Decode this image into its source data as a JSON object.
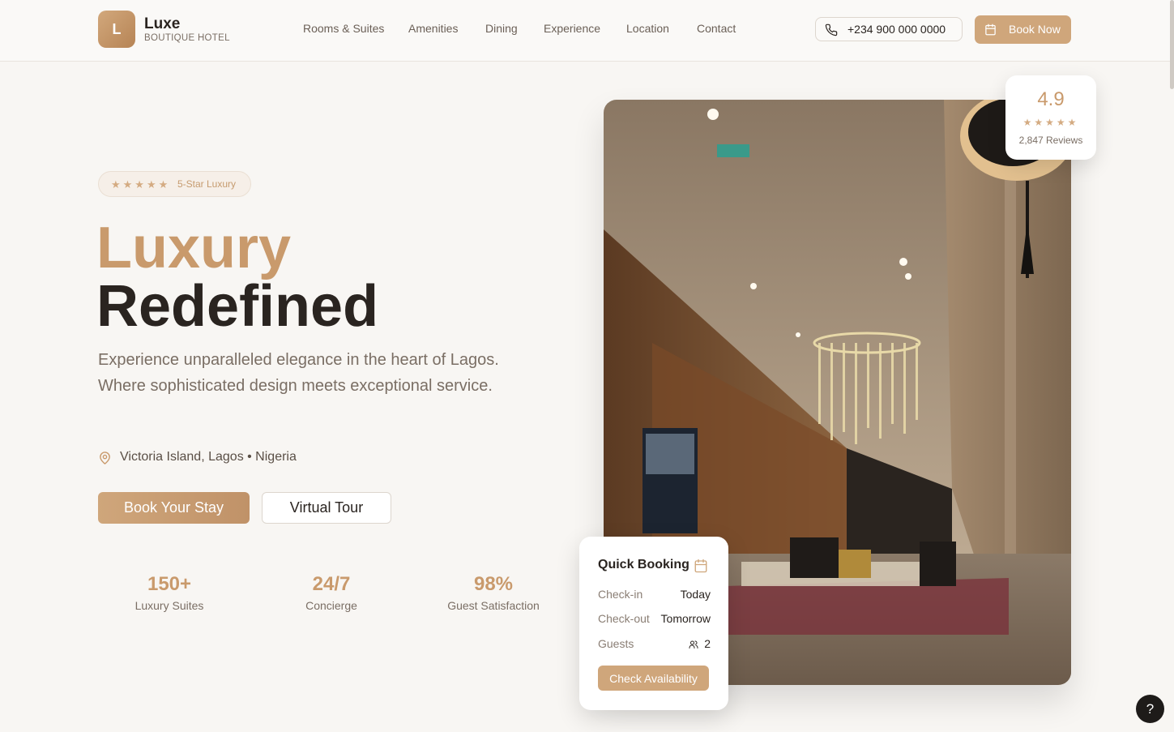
{
  "brand": {
    "initial": "L",
    "name": "Luxe",
    "tagline": "BOUTIQUE HOTEL"
  },
  "nav": {
    "items": [
      {
        "label": "Rooms & Suites"
      },
      {
        "label": "Amenities"
      },
      {
        "label": "Dining"
      },
      {
        "label": "Experience"
      },
      {
        "label": "Location"
      },
      {
        "label": "Contact"
      }
    ]
  },
  "header": {
    "phone": "+234 900 000 0000",
    "book_label": "Book Now"
  },
  "hero": {
    "badge_stars": "★★★★★",
    "badge_label": "5-Star Luxury",
    "title_line1": "Luxury",
    "title_line2": "Redefined",
    "subtitle": "Experience unparalleled elegance in the heart of Lagos. Where sophisticated design meets exceptional service.",
    "location": "Victoria Island, Lagos • Nigeria",
    "primary_cta": "Book Your Stay",
    "secondary_cta": "Virtual Tour"
  },
  "stats": [
    {
      "value": "150+",
      "label": "Luxury Suites"
    },
    {
      "value": "24/7",
      "label": "Concierge"
    },
    {
      "value": "98%",
      "label": "Guest Satisfaction"
    }
  ],
  "rating": {
    "score": "4.9",
    "stars": "★★★★★",
    "reviews": "2,847 Reviews"
  },
  "quick_booking": {
    "title": "Quick Booking",
    "checkin_label": "Check-in",
    "checkin_value": "Today",
    "checkout_label": "Check-out",
    "checkout_value": "Tomorrow",
    "guests_label": "Guests",
    "guests_value": "2",
    "cta": "Check Availability"
  },
  "help_label": "?",
  "colors": {
    "accent": "#cfa67b",
    "accent_text": "#c99a6c",
    "dark": "#2a2420",
    "background": "#f8f6f3"
  },
  "icons": {
    "phone": "phone-icon",
    "calendar": "calendar-icon",
    "location": "map-pin-icon",
    "guests": "users-icon"
  }
}
